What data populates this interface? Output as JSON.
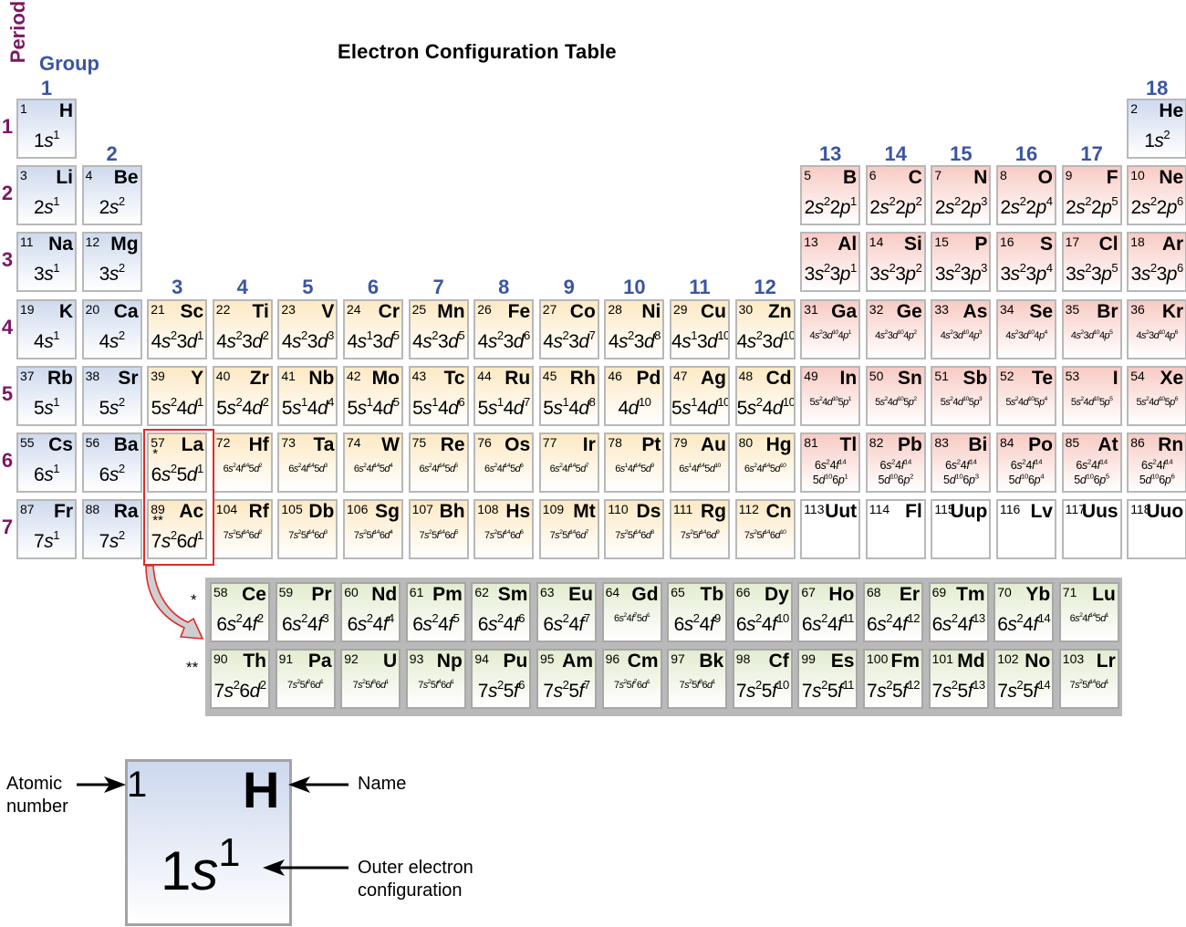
{
  "title": "Electron Configuration Table",
  "axis_labels": {
    "period": "Period",
    "group": "Group"
  },
  "colors": {
    "s_block": "#cfdaee",
    "d_block": "#fde9c4",
    "p_block": "#f8cbc4",
    "f_block": "#e3ecd0",
    "group_numbers": "#3a55a4",
    "period_numbers": "#7b1766",
    "highlight": "#e02a2a"
  },
  "groups": [
    "1",
    "2",
    "3",
    "4",
    "5",
    "6",
    "7",
    "8",
    "9",
    "10",
    "11",
    "12",
    "13",
    "14",
    "15",
    "16",
    "17",
    "18"
  ],
  "periods": [
    "1",
    "2",
    "3",
    "4",
    "5",
    "6",
    "7"
  ],
  "lanthanide_marker": "*",
  "actinide_marker": "**",
  "elements": [
    {
      "n": "1",
      "sym": "H",
      "cfg": "1s^1",
      "block": "s",
      "period": 1,
      "group": 1
    },
    {
      "n": "2",
      "sym": "He",
      "cfg": "1s^2",
      "block": "s",
      "period": 1,
      "group": 18
    },
    {
      "n": "3",
      "sym": "Li",
      "cfg": "2s^1",
      "block": "s",
      "period": 2,
      "group": 1
    },
    {
      "n": "4",
      "sym": "Be",
      "cfg": "2s^2",
      "block": "s",
      "period": 2,
      "group": 2
    },
    {
      "n": "5",
      "sym": "B",
      "cfg": "2s^2 2p^1",
      "block": "p",
      "period": 2,
      "group": 13
    },
    {
      "n": "6",
      "sym": "C",
      "cfg": "2s^2 2p^2",
      "block": "p",
      "period": 2,
      "group": 14
    },
    {
      "n": "7",
      "sym": "N",
      "cfg": "2s^2 2p^3",
      "block": "p",
      "period": 2,
      "group": 15
    },
    {
      "n": "8",
      "sym": "O",
      "cfg": "2s^2 2p^4",
      "block": "p",
      "period": 2,
      "group": 16
    },
    {
      "n": "9",
      "sym": "F",
      "cfg": "2s^2 2p^5",
      "block": "p",
      "period": 2,
      "group": 17
    },
    {
      "n": "10",
      "sym": "Ne",
      "cfg": "2s^2 2p^6",
      "block": "p",
      "period": 2,
      "group": 18
    },
    {
      "n": "11",
      "sym": "Na",
      "cfg": "3s^1",
      "block": "s",
      "period": 3,
      "group": 1
    },
    {
      "n": "12",
      "sym": "Mg",
      "cfg": "3s^2",
      "block": "s",
      "period": 3,
      "group": 2
    },
    {
      "n": "13",
      "sym": "Al",
      "cfg": "3s^2 3p^1",
      "block": "p",
      "period": 3,
      "group": 13
    },
    {
      "n": "14",
      "sym": "Si",
      "cfg": "3s^2 3p^2",
      "block": "p",
      "period": 3,
      "group": 14
    },
    {
      "n": "15",
      "sym": "P",
      "cfg": "3s^2 3p^3",
      "block": "p",
      "period": 3,
      "group": 15
    },
    {
      "n": "16",
      "sym": "S",
      "cfg": "3s^2 3p^4",
      "block": "p",
      "period": 3,
      "group": 16
    },
    {
      "n": "17",
      "sym": "Cl",
      "cfg": "3s^2 3p^5",
      "block": "p",
      "period": 3,
      "group": 17
    },
    {
      "n": "18",
      "sym": "Ar",
      "cfg": "3s^2 3p^6",
      "block": "p",
      "period": 3,
      "group": 18
    },
    {
      "n": "19",
      "sym": "K",
      "cfg": "4s^1",
      "block": "s",
      "period": 4,
      "group": 1
    },
    {
      "n": "20",
      "sym": "Ca",
      "cfg": "4s^2",
      "block": "s",
      "period": 4,
      "group": 2
    },
    {
      "n": "21",
      "sym": "Sc",
      "cfg": "4s^2 3d^1",
      "block": "d",
      "period": 4,
      "group": 3
    },
    {
      "n": "22",
      "sym": "Ti",
      "cfg": "4s^2 3d^2",
      "block": "d",
      "period": 4,
      "group": 4
    },
    {
      "n": "23",
      "sym": "V",
      "cfg": "4s^2 3d^3",
      "block": "d",
      "period": 4,
      "group": 5
    },
    {
      "n": "24",
      "sym": "Cr",
      "cfg": "4s^1 3d^5",
      "block": "d",
      "period": 4,
      "group": 6
    },
    {
      "n": "25",
      "sym": "Mn",
      "cfg": "4s^2 3d^5",
      "block": "d",
      "period": 4,
      "group": 7
    },
    {
      "n": "26",
      "sym": "Fe",
      "cfg": "4s^2 3d^6",
      "block": "d",
      "period": 4,
      "group": 8
    },
    {
      "n": "27",
      "sym": "Co",
      "cfg": "4s^2 3d^7",
      "block": "d",
      "period": 4,
      "group": 9
    },
    {
      "n": "28",
      "sym": "Ni",
      "cfg": "4s^2 3d^8",
      "block": "d",
      "period": 4,
      "group": 10
    },
    {
      "n": "29",
      "sym": "Cu",
      "cfg": "4s^1 3d^10",
      "block": "d",
      "period": 4,
      "group": 11
    },
    {
      "n": "30",
      "sym": "Zn",
      "cfg": "4s^2 3d^10",
      "block": "d",
      "period": 4,
      "group": 12
    },
    {
      "n": "31",
      "sym": "Ga",
      "cfg": "4s^2 3d^10 4p^1",
      "block": "p",
      "period": 4,
      "group": 13,
      "small": true
    },
    {
      "n": "32",
      "sym": "Ge",
      "cfg": "4s^2 3d^10 4p^2",
      "block": "p",
      "period": 4,
      "group": 14,
      "small": true
    },
    {
      "n": "33",
      "sym": "As",
      "cfg": "4s^2 3d^10 4p^3",
      "block": "p",
      "period": 4,
      "group": 15,
      "small": true
    },
    {
      "n": "34",
      "sym": "Se",
      "cfg": "4s^2 3d^10 4p^4",
      "block": "p",
      "period": 4,
      "group": 16,
      "small": true
    },
    {
      "n": "35",
      "sym": "Br",
      "cfg": "4s^2 3d^10 4p^5",
      "block": "p",
      "period": 4,
      "group": 17,
      "small": true
    },
    {
      "n": "36",
      "sym": "Kr",
      "cfg": "4s^2 3d^10 4p^6",
      "block": "p",
      "period": 4,
      "group": 18,
      "small": true
    },
    {
      "n": "37",
      "sym": "Rb",
      "cfg": "5s^1",
      "block": "s",
      "period": 5,
      "group": 1
    },
    {
      "n": "38",
      "sym": "Sr",
      "cfg": "5s^2",
      "block": "s",
      "period": 5,
      "group": 2
    },
    {
      "n": "39",
      "sym": "Y",
      "cfg": "5s^2 4d^1",
      "block": "d",
      "period": 5,
      "group": 3
    },
    {
      "n": "40",
      "sym": "Zr",
      "cfg": "5s^2 4d^2",
      "block": "d",
      "period": 5,
      "group": 4
    },
    {
      "n": "41",
      "sym": "Nb",
      "cfg": "5s^1 4d^4",
      "block": "d",
      "period": 5,
      "group": 5
    },
    {
      "n": "42",
      "sym": "Mo",
      "cfg": "5s^1 4d^5",
      "block": "d",
      "period": 5,
      "group": 6
    },
    {
      "n": "43",
      "sym": "Tc",
      "cfg": "5s^1 4d^6",
      "block": "d",
      "period": 5,
      "group": 7
    },
    {
      "n": "44",
      "sym": "Ru",
      "cfg": "5s^1 4d^7",
      "block": "d",
      "period": 5,
      "group": 8
    },
    {
      "n": "45",
      "sym": "Rh",
      "cfg": "5s^1 4d^8",
      "block": "d",
      "period": 5,
      "group": 9
    },
    {
      "n": "46",
      "sym": "Pd",
      "cfg": "4d^10",
      "block": "d",
      "period": 5,
      "group": 10
    },
    {
      "n": "47",
      "sym": "Ag",
      "cfg": "5s^1 4d^10",
      "block": "d",
      "period": 5,
      "group": 11
    },
    {
      "n": "48",
      "sym": "Cd",
      "cfg": "5s^2 4d^10",
      "block": "d",
      "period": 5,
      "group": 12
    },
    {
      "n": "49",
      "sym": "In",
      "cfg": "5s^2 4d^10 5p^1",
      "block": "p",
      "period": 5,
      "group": 13,
      "small": true
    },
    {
      "n": "50",
      "sym": "Sn",
      "cfg": "5s^2 4d^10 5p^2",
      "block": "p",
      "period": 5,
      "group": 14,
      "small": true
    },
    {
      "n": "51",
      "sym": "Sb",
      "cfg": "5s^2 4d^10 5p^3",
      "block": "p",
      "period": 5,
      "group": 15,
      "small": true
    },
    {
      "n": "52",
      "sym": "Te",
      "cfg": "5s^2 4d^10 5p^4",
      "block": "p",
      "period": 5,
      "group": 16,
      "small": true
    },
    {
      "n": "53",
      "sym": "I",
      "cfg": "5s^2 4d^10 5p^5",
      "block": "p",
      "period": 5,
      "group": 17,
      "small": true
    },
    {
      "n": "54",
      "sym": "Xe",
      "cfg": "5s^2 4d^10 5p^6",
      "block": "p",
      "period": 5,
      "group": 18,
      "small": true
    },
    {
      "n": "55",
      "sym": "Cs",
      "cfg": "6s^1",
      "block": "s",
      "period": 6,
      "group": 1
    },
    {
      "n": "56",
      "sym": "Ba",
      "cfg": "6s^2",
      "block": "s",
      "period": 6,
      "group": 2
    },
    {
      "n": "57",
      "sym": "La",
      "cfg": "6s^2 5d^1",
      "block": "d",
      "period": 6,
      "group": 3,
      "star": "*"
    },
    {
      "n": "72",
      "sym": "Hf",
      "cfg": "6s^2 4f^14 5d^2",
      "block": "d",
      "period": 6,
      "group": 4,
      "small": true
    },
    {
      "n": "73",
      "sym": "Ta",
      "cfg": "6s^2 4f^14 5d^3",
      "block": "d",
      "period": 6,
      "group": 5,
      "small": true
    },
    {
      "n": "74",
      "sym": "W",
      "cfg": "6s^2 4f^14 5d^4",
      "block": "d",
      "period": 6,
      "group": 6,
      "small": true
    },
    {
      "n": "75",
      "sym": "Re",
      "cfg": "6s^2 4f^14 5d^5",
      "block": "d",
      "period": 6,
      "group": 7,
      "small": true
    },
    {
      "n": "76",
      "sym": "Os",
      "cfg": "6s^2 4f^14 5d^6",
      "block": "d",
      "period": 6,
      "group": 8,
      "small": true
    },
    {
      "n": "77",
      "sym": "Ir",
      "cfg": "6s^2 4f^14 5d^7",
      "block": "d",
      "period": 6,
      "group": 9,
      "small": true
    },
    {
      "n": "78",
      "sym": "Pt",
      "cfg": "6s^1 4f^14 5d^9",
      "block": "d",
      "period": 6,
      "group": 10,
      "small": true
    },
    {
      "n": "79",
      "sym": "Au",
      "cfg": "6s^1 4f^14 5d^10",
      "block": "d",
      "period": 6,
      "group": 11,
      "small": true
    },
    {
      "n": "80",
      "sym": "Hg",
      "cfg": "6s^2 4f^14 5d^10",
      "block": "d",
      "period": 6,
      "group": 12,
      "small": true
    },
    {
      "n": "81",
      "sym": "Tl",
      "cfg": "6s^2 4f^14|5d^10 6p^1",
      "block": "p",
      "period": 6,
      "group": 13,
      "two": true
    },
    {
      "n": "82",
      "sym": "Pb",
      "cfg": "6s^2 4f^14|5d^10 6p^2",
      "block": "p",
      "period": 6,
      "group": 14,
      "two": true
    },
    {
      "n": "83",
      "sym": "Bi",
      "cfg": "6s^2 4f^14|5d^10 6p^3",
      "block": "p",
      "period": 6,
      "group": 15,
      "two": true
    },
    {
      "n": "84",
      "sym": "Po",
      "cfg": "6s^2 4f^14|5d^10 6p^4",
      "block": "p",
      "period": 6,
      "group": 16,
      "two": true
    },
    {
      "n": "85",
      "sym": "At",
      "cfg": "6s^2 4f^14|5d^10 6p^5",
      "block": "p",
      "period": 6,
      "group": 17,
      "two": true
    },
    {
      "n": "86",
      "sym": "Rn",
      "cfg": "6s^2 4f^14|5d^10 6p^6",
      "block": "p",
      "period": 6,
      "group": 18,
      "two": true
    },
    {
      "n": "87",
      "sym": "Fr",
      "cfg": "7s^1",
      "block": "s",
      "period": 7,
      "group": 1
    },
    {
      "n": "88",
      "sym": "Ra",
      "cfg": "7s^2",
      "block": "s",
      "period": 7,
      "group": 2
    },
    {
      "n": "89",
      "sym": "Ac",
      "cfg": "7s^2 6d^1",
      "block": "d",
      "period": 7,
      "group": 3,
      "star": "**"
    },
    {
      "n": "104",
      "sym": "Rf",
      "cfg": "7s^2 5f^14 6d^2",
      "block": "d",
      "period": 7,
      "group": 4,
      "small": true
    },
    {
      "n": "105",
      "sym": "Db",
      "cfg": "7s^2 5f^14 6d^3",
      "block": "d",
      "period": 7,
      "group": 5,
      "small": true
    },
    {
      "n": "106",
      "sym": "Sg",
      "cfg": "7s^2 5f^14 6d^4",
      "block": "d",
      "period": 7,
      "group": 6,
      "small": true
    },
    {
      "n": "107",
      "sym": "Bh",
      "cfg": "7s^2 5f^14 6d^5",
      "block": "d",
      "period": 7,
      "group": 7,
      "small": true
    },
    {
      "n": "108",
      "sym": "Hs",
      "cfg": "7s^2 5f^14 6d^6",
      "block": "d",
      "period": 7,
      "group": 8,
      "small": true
    },
    {
      "n": "109",
      "sym": "Mt",
      "cfg": "7s^2 5f^14 6d^7",
      "block": "d",
      "period": 7,
      "group": 9,
      "small": true
    },
    {
      "n": "110",
      "sym": "Ds",
      "cfg": "7s^2 5f^14 6d^8",
      "block": "d",
      "period": 7,
      "group": 10,
      "small": true
    },
    {
      "n": "111",
      "sym": "Rg",
      "cfg": "7s^2 5f^14 6d^9",
      "block": "d",
      "period": 7,
      "group": 11,
      "small": true
    },
    {
      "n": "112",
      "sym": "Cn",
      "cfg": "7s^2 5f^14 6d^10",
      "block": "d",
      "period": 7,
      "group": 12,
      "small": true
    },
    {
      "n": "113",
      "sym": "Uut",
      "cfg": "",
      "block": "u",
      "period": 7,
      "group": 13
    },
    {
      "n": "114",
      "sym": "Fl",
      "cfg": "",
      "block": "u",
      "period": 7,
      "group": 14
    },
    {
      "n": "115",
      "sym": "Uup",
      "cfg": "",
      "block": "u",
      "period": 7,
      "group": 15
    },
    {
      "n": "116",
      "sym": "Lv",
      "cfg": "",
      "block": "u",
      "period": 7,
      "group": 16
    },
    {
      "n": "117",
      "sym": "Uus",
      "cfg": "",
      "block": "u",
      "period": 7,
      "group": 17
    },
    {
      "n": "118",
      "sym": "Uuo",
      "cfg": "",
      "block": "u",
      "period": 7,
      "group": 18
    }
  ],
  "lanthanides": [
    {
      "n": "58",
      "sym": "Ce",
      "cfg": "6s^2 4f^2"
    },
    {
      "n": "59",
      "sym": "Pr",
      "cfg": "6s^2 4f^3"
    },
    {
      "n": "60",
      "sym": "Nd",
      "cfg": "6s^2 4f^4"
    },
    {
      "n": "61",
      "sym": "Pm",
      "cfg": "6s^2 4f^5"
    },
    {
      "n": "62",
      "sym": "Sm",
      "cfg": "6s^2 4f^6"
    },
    {
      "n": "63",
      "sym": "Eu",
      "cfg": "6s^2 4f^7"
    },
    {
      "n": "64",
      "sym": "Gd",
      "cfg": "6s^2 4f^7 5d^1",
      "small": true
    },
    {
      "n": "65",
      "sym": "Tb",
      "cfg": "6s^2 4f^9"
    },
    {
      "n": "66",
      "sym": "Dy",
      "cfg": "6s^2 4f^10"
    },
    {
      "n": "67",
      "sym": "Ho",
      "cfg": "6s^2 4f^11"
    },
    {
      "n": "68",
      "sym": "Er",
      "cfg": "6s^2 4f^12"
    },
    {
      "n": "69",
      "sym": "Tm",
      "cfg": "6s^2 4f^13"
    },
    {
      "n": "70",
      "sym": "Yb",
      "cfg": "6s^2 4f^14"
    },
    {
      "n": "71",
      "sym": "Lu",
      "cfg": "6s^2 4f^14 5d^1",
      "small": true
    }
  ],
  "actinides": [
    {
      "n": "90",
      "sym": "Th",
      "cfg": "7s^2 6d^2"
    },
    {
      "n": "91",
      "sym": "Pa",
      "cfg": "7s^2 5f^2 6d^1",
      "small": true
    },
    {
      "n": "92",
      "sym": "U",
      "cfg": "7s^2 5f^3 6d^1",
      "small": true
    },
    {
      "n": "93",
      "sym": "Np",
      "cfg": "7s^2 5f^4 6d^1",
      "small": true
    },
    {
      "n": "94",
      "sym": "Pu",
      "cfg": "7s^2 5f^6"
    },
    {
      "n": "95",
      "sym": "Am",
      "cfg": "7s^2 5f^7"
    },
    {
      "n": "96",
      "sym": "Cm",
      "cfg": "7s^2 5f^7 6d^1",
      "small": true
    },
    {
      "n": "97",
      "sym": "Bk",
      "cfg": "7s^2 5f^8 6d^1",
      "small": true
    },
    {
      "n": "98",
      "sym": "Cf",
      "cfg": "7s^2 5f^10"
    },
    {
      "n": "99",
      "sym": "Es",
      "cfg": "7s^2 5f^11"
    },
    {
      "n": "100",
      "sym": "Fm",
      "cfg": "7s^2 5f^12"
    },
    {
      "n": "101",
      "sym": "Md",
      "cfg": "7s^2 5f^13"
    },
    {
      "n": "102",
      "sym": "No",
      "cfg": "7s^2 5f^14"
    },
    {
      "n": "103",
      "sym": "Lr",
      "cfg": "7s^2 5f^14 6d^1",
      "small": true
    }
  ],
  "legend": {
    "atomic_number": "1",
    "symbol": "H",
    "config_base": "1s",
    "config_sup": "1",
    "label_atomic_line1": "Atomic",
    "label_atomic_line2": "number",
    "label_name": "Name",
    "label_config_line1": "Outer electron",
    "label_config_line2": "configuration"
  }
}
